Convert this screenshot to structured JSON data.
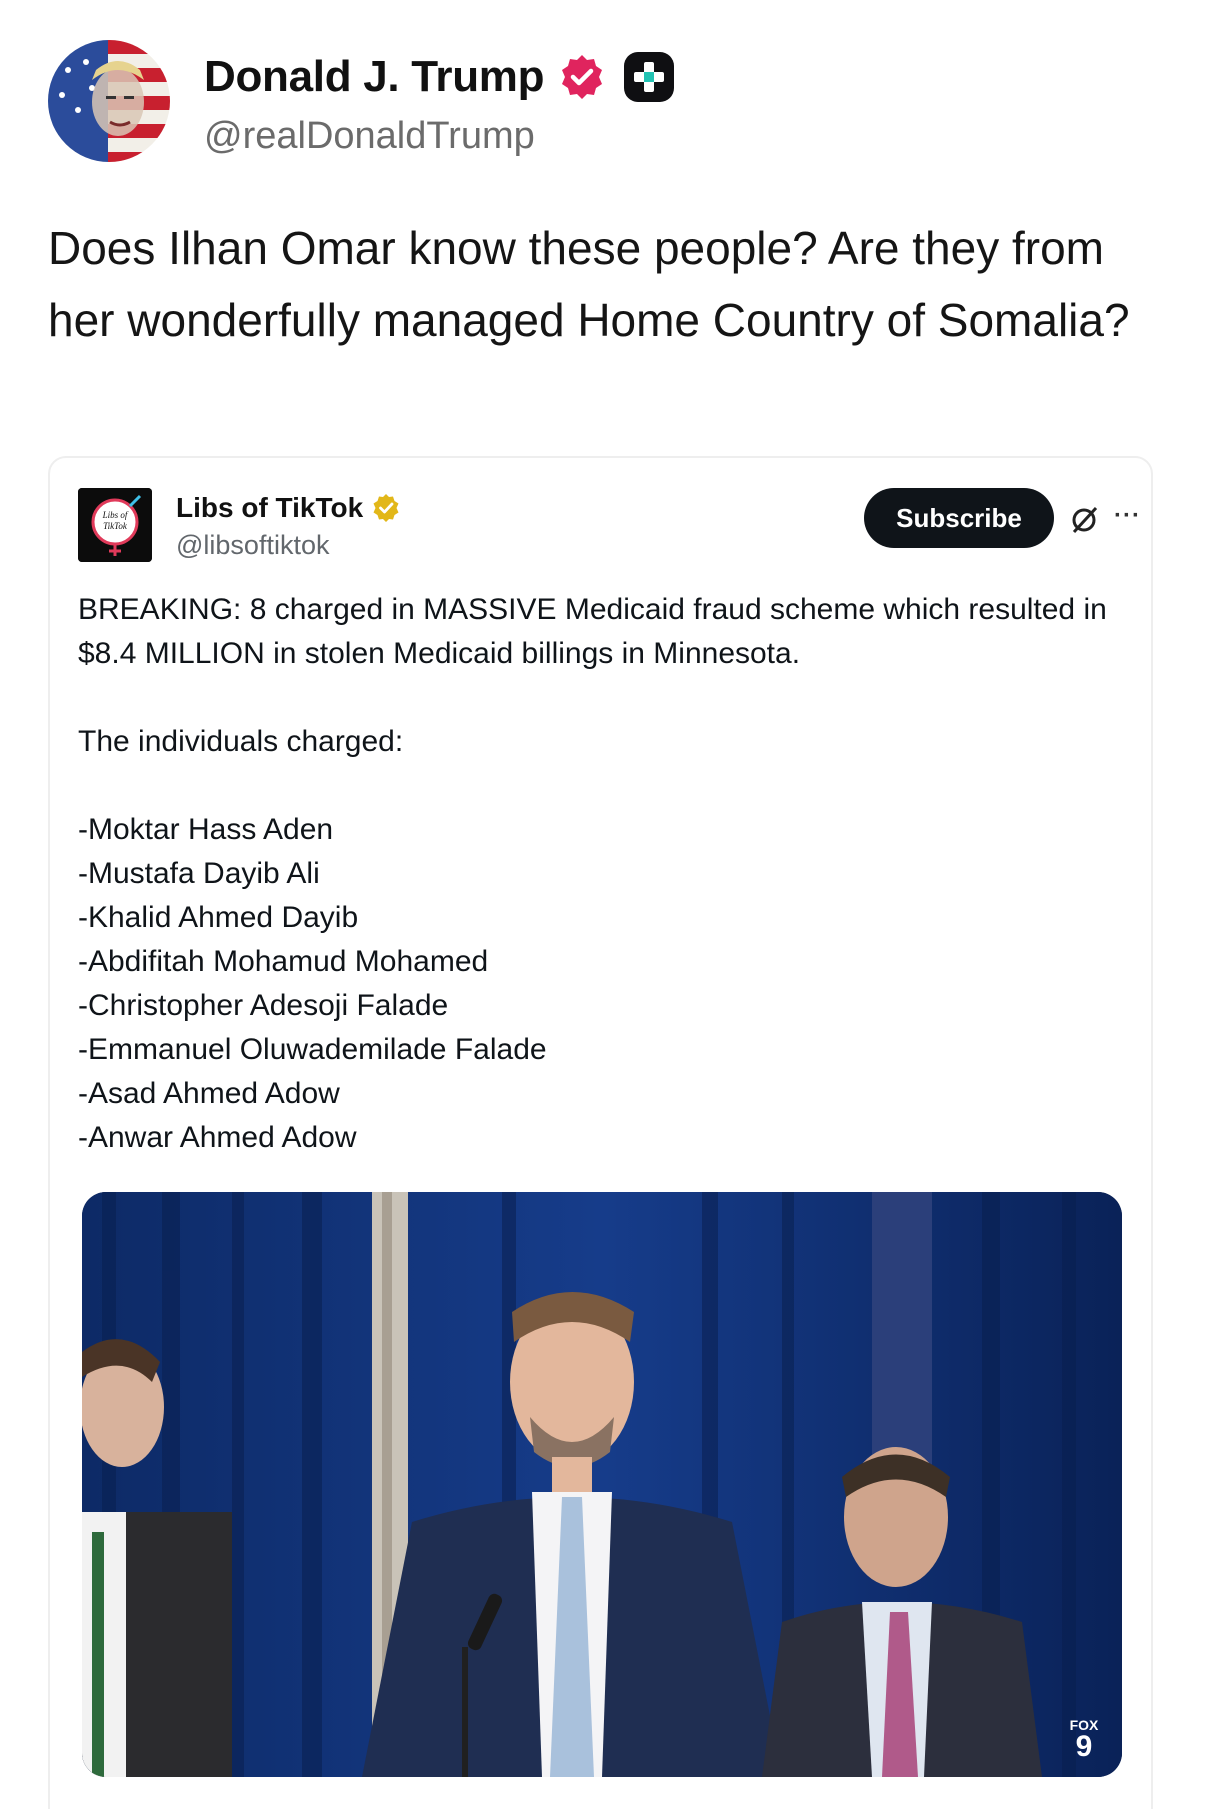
{
  "post": {
    "author_name": "Donald J. Trump",
    "author_handle": "@realDonaldTrump",
    "verified_badge_color": "#e0245e",
    "text": "Does Ilhan Omar know these people? Are they from her wonderfully managed Home Country of Somalia?"
  },
  "embed": {
    "author_name": "Libs of TikTok",
    "author_handle": "@libsoftiktok",
    "avatar_text_line1": "Libs of",
    "avatar_text_line2": "TikTok",
    "subscribe_label": "Subscribe",
    "more_label": "···",
    "gold_check_color": "#e2b719",
    "paragraph1": "BREAKING: 8 charged in MASSIVE Medicaid fraud scheme which resulted in $8.4 MILLION in stolen Medicaid billings in Minnesota.",
    "paragraph2": "The individuals charged:",
    "names": [
      "-Moktar Hass Aden",
      "-Mustafa Dayib Ali",
      "-Khalid Ahmed Dayib",
      "-Abdifitah Mohamud Mohamed",
      "-Christopher Adesoji Falade",
      "-Emmanuel Oluwademilade Falade",
      "-Asad Ahmed Adow",
      "-Anwar Ahmed Adow"
    ],
    "media": {
      "watermark_top": "FOX",
      "watermark_bottom": "9"
    }
  }
}
